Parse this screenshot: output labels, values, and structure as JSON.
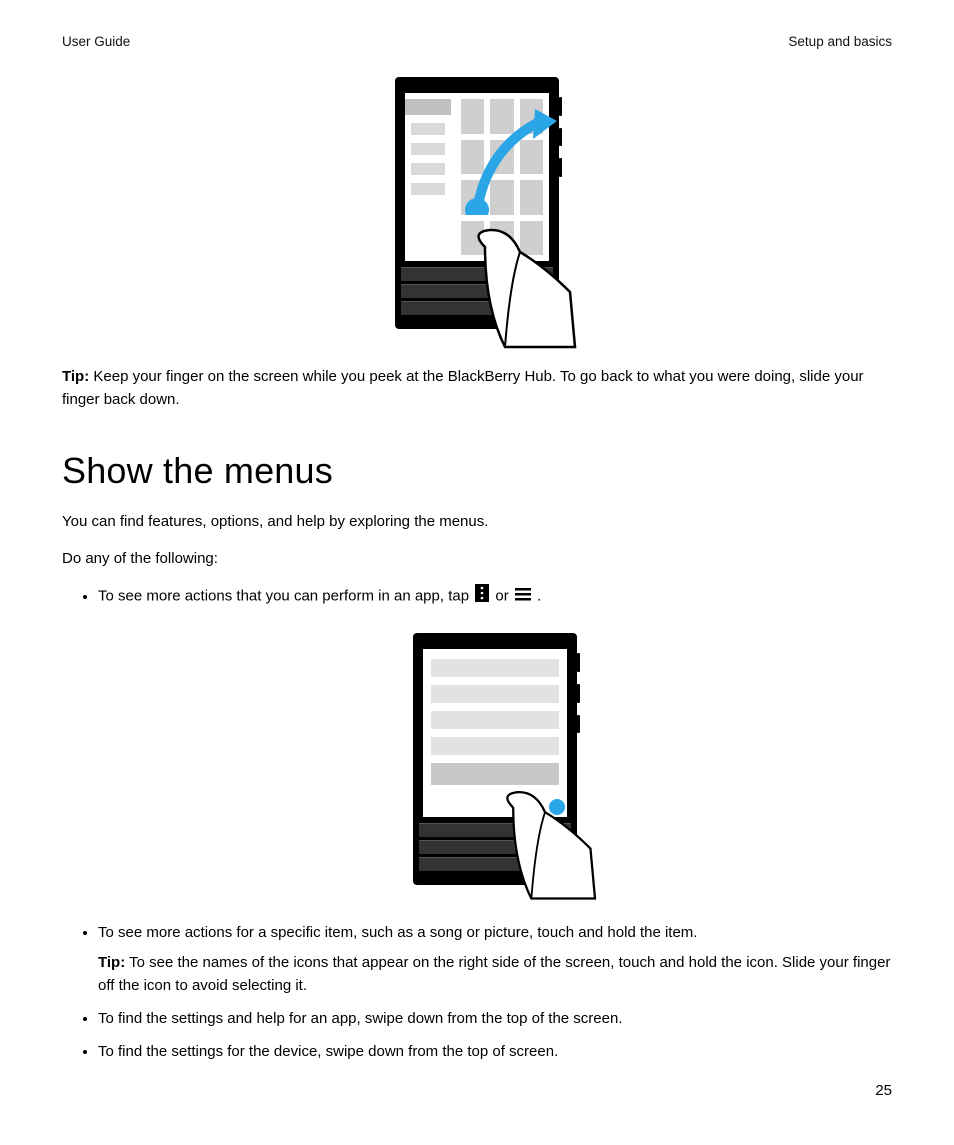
{
  "header": {
    "left": "User Guide",
    "right": "Setup and basics"
  },
  "tip1": {
    "label": "Tip:",
    "text": " Keep your finger on the screen while you peek at the BlackBerry Hub. To go back to what you were doing, slide your finger back down."
  },
  "section_title": "Show the menus",
  "intro1": "You can find features, options, and help by exploring the menus.",
  "intro2": "Do any of the following:",
  "bullet1_a": "To see more actions that you can perform in an app, tap ",
  "bullet1_b": " or ",
  "bullet1_c": " .",
  "bullet2": "To see more actions for a specific item, such as a song or picture, touch and hold the item.",
  "bullet2_tip_label": "Tip:",
  "bullet2_tip_text": " To see the names of the icons that appear on the right side of the screen, touch and hold the icon. Slide your finger off the icon to avoid selecting it.",
  "bullet3": "To find the settings and help for an app, swipe down from the top of the screen.",
  "bullet4": "To find the settings for the device, swipe down from the top of screen.",
  "page_number": "25"
}
